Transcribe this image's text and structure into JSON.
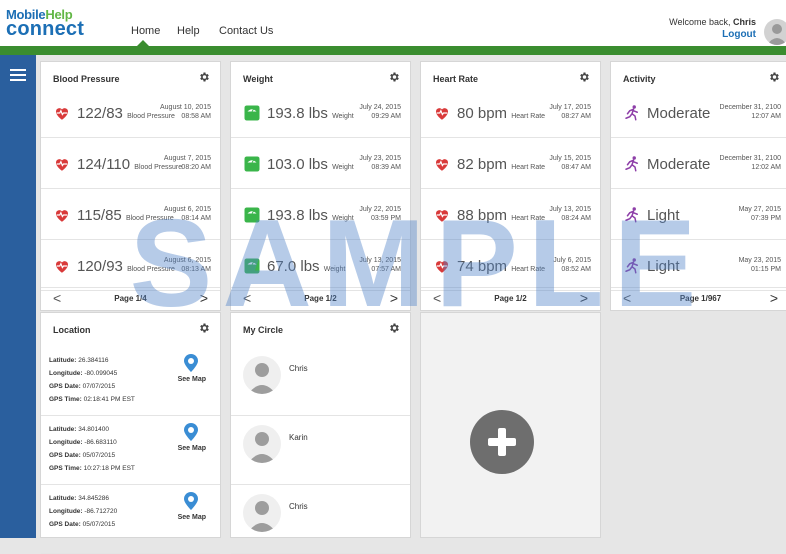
{
  "header": {
    "logo_top": "Mobile",
    "logo_top_accent": "Help",
    "logo_bottom": "connect",
    "nav": [
      "Home",
      "Help",
      "Contact Us"
    ],
    "welcome_prefix": "Welcome back, ",
    "welcome_user": "Chris",
    "logout": "Logout"
  },
  "cards": [
    {
      "title": "Blood Pressure",
      "icon": "heart-icon",
      "color": "#d93a3a",
      "rows": [
        {
          "value": "122/83",
          "unit": "Blood Pressure",
          "date": "August 10, 2015",
          "time": "08:58 AM"
        },
        {
          "value": "124/110",
          "unit": "Blood Pressure",
          "date": "August 7, 2015",
          "time": "08:20 AM"
        },
        {
          "value": "115/85",
          "unit": "Blood Pressure",
          "date": "August 6, 2015",
          "time": "08:14 AM"
        },
        {
          "value": "120/93",
          "unit": "Blood Pressure",
          "date": "August 6, 2015",
          "time": "08:13 AM"
        }
      ],
      "page": "Page 1/4"
    },
    {
      "title": "Weight",
      "icon": "scale-icon",
      "color": "#3ab54a",
      "rows": [
        {
          "value": "193.8 lbs",
          "unit": "Weight",
          "date": "July 24, 2015",
          "time": "09:29 AM"
        },
        {
          "value": "103.0 lbs",
          "unit": "Weight",
          "date": "July 23, 2015",
          "time": "08:39 AM"
        },
        {
          "value": "193.8 lbs",
          "unit": "Weight",
          "date": "July 22, 2015",
          "time": "03:59 PM"
        },
        {
          "value": "67.0 lbs",
          "unit": "Weight",
          "date": "July 13, 2015",
          "time": "07:57 AM"
        }
      ],
      "page": "Page 1/2"
    },
    {
      "title": "Heart Rate",
      "icon": "heart-icon",
      "color": "#d93a3a",
      "rows": [
        {
          "value": "80 bpm",
          "unit": "Heart Rate",
          "date": "July 17, 2015",
          "time": "08:27 AM"
        },
        {
          "value": "82 bpm",
          "unit": "Heart Rate",
          "date": "July 15, 2015",
          "time": "08:47 AM"
        },
        {
          "value": "88 bpm",
          "unit": "Heart Rate",
          "date": "July 13, 2015",
          "time": "08:24 AM"
        },
        {
          "value": "74 bpm",
          "unit": "Heart Rate",
          "date": "July 6, 2015",
          "time": "08:52 AM"
        }
      ],
      "page": "Page 1/2"
    },
    {
      "title": "Activity",
      "icon": "runner-icon",
      "color": "#8e3fa8",
      "rows": [
        {
          "value": "Moderate",
          "unit": "",
          "date": "December 31, 2100",
          "time": "12:07 AM"
        },
        {
          "value": "Moderate",
          "unit": "",
          "date": "December 31, 2100",
          "time": "12:02 AM"
        },
        {
          "value": "Light",
          "unit": "",
          "date": "May 27, 2015",
          "time": "07:39 PM"
        },
        {
          "value": "Light",
          "unit": "",
          "date": "May 23, 2015",
          "time": "01:15 PM"
        }
      ],
      "page": "Page 1/967"
    }
  ],
  "pager": {
    "prev": "<",
    "next": ">"
  },
  "location": {
    "title": "Location",
    "labels": {
      "lat": "Latitude:",
      "lon": "Longitude:",
      "date": "GPS Date:",
      "time": "GPS Time:"
    },
    "see_map": "See Map",
    "entries": [
      {
        "lat": "26.384116",
        "lon": "-80.099045",
        "date": "07/07/2015",
        "time": "02:18:41 PM EST"
      },
      {
        "lat": "34.801400",
        "lon": "-86.683110",
        "date": "05/07/2015",
        "time": "10:27:18 PM EST"
      },
      {
        "lat": "34.845286",
        "lon": "-86.712720",
        "date": "05/07/2015",
        "time": ""
      }
    ],
    "pin_color": "#3a8dd4"
  },
  "circle": {
    "title": "My Circle",
    "members": [
      "Chris",
      "Karin",
      "Chris"
    ]
  },
  "watermark": "SAMPLE",
  "colors": {
    "brand_blue": "#1c6fb5",
    "brand_green": "#3a8d2f",
    "sidebar": "#2a5f9e"
  }
}
